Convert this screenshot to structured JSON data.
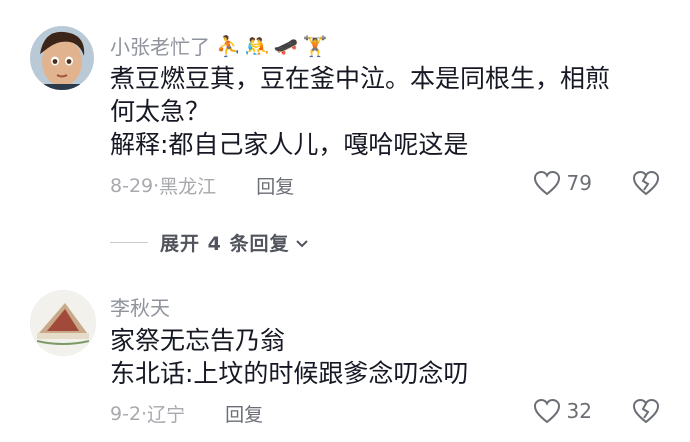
{
  "comments": [
    {
      "username": "小张老忙了",
      "emoji_icons": [
        "basketball-player-icon",
        "wrestler-icon",
        "skateboarder-icon",
        "weightlifter-icon"
      ],
      "text_line1": "煮豆燃豆萁，豆在釜中泣。本是同根生，相煎",
      "text_line2": "何太急？",
      "text_line3": "解释:都自己家人儿，嘎哈呢这是",
      "date": "8-29",
      "location": "黑龙江",
      "reply_label": "回复",
      "like_count": "79"
    },
    {
      "username": "李秋天",
      "text_line1": "家祭无忘告乃翁",
      "text_line2": "东北话:上坟的时候跟爹念叨念叨",
      "date": "9-2",
      "location": "辽宁",
      "reply_label": "回复",
      "like_count": "32"
    }
  ],
  "expand": {
    "label": "展开 4 条回复"
  },
  "colors": {
    "text": "#161823",
    "meta": "#a7a9ae",
    "username": "#8f939c"
  }
}
